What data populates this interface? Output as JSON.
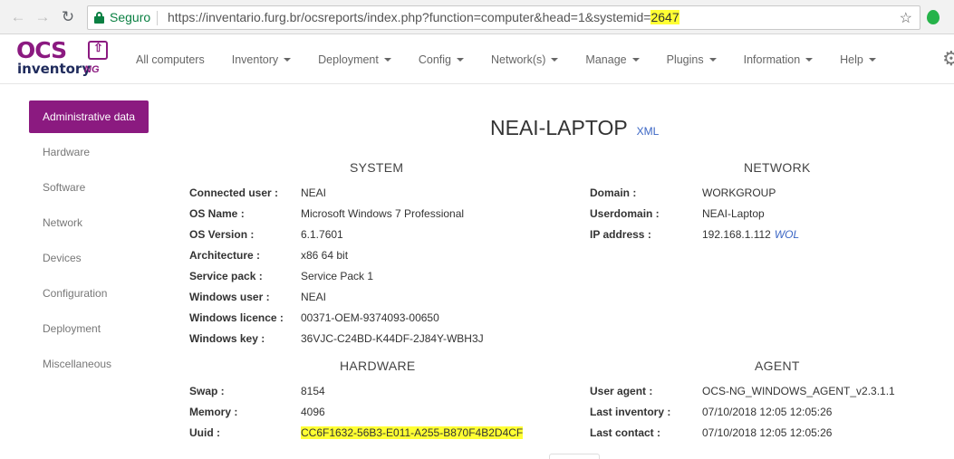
{
  "browser": {
    "secure_label": "Seguro",
    "url_prefix": "https://inventario.furg.br/ocsreports/index.php?function=computer&head=1&systemid=",
    "url_highlight": "2647"
  },
  "icons": {
    "back": "←",
    "forward": "→",
    "reload": "↻",
    "star": "☆",
    "gear": "⚙",
    "logo_arrow": "⇧"
  },
  "brand": {
    "logo_top": "OCS",
    "logo_bottom": "inventory",
    "logo_suffix": "NG",
    "accent_color": "#8b1a80"
  },
  "menu": [
    {
      "label": "All computers",
      "dropdown": false
    },
    {
      "label": "Inventory",
      "dropdown": true
    },
    {
      "label": "Deployment",
      "dropdown": true
    },
    {
      "label": "Config",
      "dropdown": true
    },
    {
      "label": "Network(s)",
      "dropdown": true
    },
    {
      "label": "Manage",
      "dropdown": true
    },
    {
      "label": "Plugins",
      "dropdown": true
    },
    {
      "label": "Information",
      "dropdown": true
    },
    {
      "label": "Help",
      "dropdown": true
    }
  ],
  "sidebar": {
    "items": [
      {
        "label": "Administrative data",
        "active": true
      },
      {
        "label": "Hardware"
      },
      {
        "label": "Software"
      },
      {
        "label": "Network"
      },
      {
        "label": "Devices"
      },
      {
        "label": "Configuration"
      },
      {
        "label": "Deployment"
      },
      {
        "label": "Miscellaneous"
      }
    ]
  },
  "computer": {
    "name": "NEAI-LAPTOP",
    "xml_link": "XML"
  },
  "system": {
    "heading": "SYSTEM",
    "rows": [
      {
        "key": "Connected user :",
        "value": "NEAI"
      },
      {
        "key": "OS Name :",
        "value": "Microsoft Windows 7 Professional"
      },
      {
        "key": "OS Version :",
        "value": "6.1.7601"
      },
      {
        "key": "Architecture :",
        "value": "x86 64 bit"
      },
      {
        "key": "Service pack :",
        "value": "Service Pack 1"
      },
      {
        "key": "Windows user :",
        "value": "NEAI"
      },
      {
        "key": "Windows licence :",
        "value": "00371-OEM-9374093-00650"
      },
      {
        "key": "Windows key :",
        "value": "36VJC-C24BD-K44DF-2J84Y-WBH3J"
      }
    ]
  },
  "network": {
    "heading": "NETWORK",
    "rows": [
      {
        "key": "Domain :",
        "value": "WORKGROUP"
      },
      {
        "key": "Userdomain :",
        "value": "NEAI-Laptop"
      },
      {
        "key": "IP address :",
        "value": "192.168.1.112"
      }
    ],
    "wol_link": "WOL"
  },
  "hardware": {
    "heading": "HARDWARE",
    "rows": [
      {
        "key": "Swap :",
        "value": "8154"
      },
      {
        "key": "Memory :",
        "value": "4096"
      },
      {
        "key": "Uuid :",
        "value": "CC6F1632-56B3-E011-A255-B870F4B2D4CF"
      }
    ]
  },
  "agent": {
    "heading": "AGENT",
    "rows": [
      {
        "key": "User agent :",
        "value": "OCS-NG_WINDOWS_AGENT_v2.3.1.1"
      },
      {
        "key": "Last inventory :",
        "value": "07/10/2018 12:05 12:05:26"
      },
      {
        "key": "Last contact :",
        "value": "07/10/2018 12:05 12:05:26"
      }
    ]
  }
}
